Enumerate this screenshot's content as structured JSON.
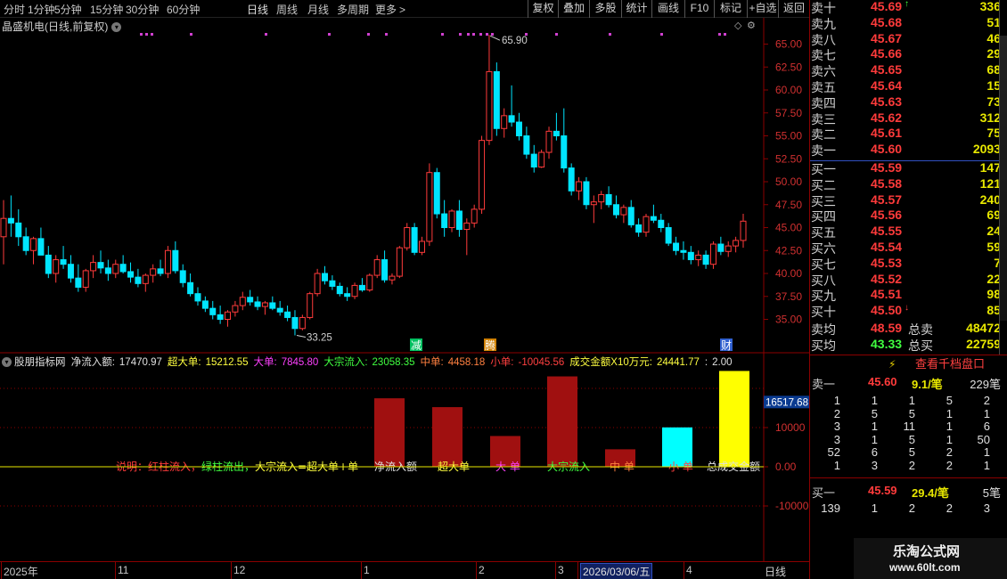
{
  "toolbar": {
    "left_items": [
      "分时",
      "1分钟",
      "5分钟",
      "15分钟",
      "30分钟",
      "60分钟",
      "日线",
      "周线",
      "月线",
      "多周期",
      "更多"
    ],
    "active": "日线",
    "right_items": [
      "复权",
      "叠加",
      "多股",
      "统计",
      "画线",
      "F10",
      "标记",
      "+自选",
      "返回"
    ]
  },
  "stock": {
    "title": "晶盛机电(日线,前复权)"
  },
  "main_chart": {
    "y_ticks": [
      "65.00",
      "62.50",
      "60.00",
      "57.50",
      "55.00",
      "52.50",
      "50.00",
      "47.50",
      "45.00",
      "42.50",
      "40.00",
      "37.50",
      "35.00"
    ],
    "high_label": "65.90",
    "low_label": "33.25",
    "event_marks": [
      {
        "text": "减",
        "color": "#00c060"
      },
      {
        "text": "腾",
        "color": "#d08000"
      },
      {
        "text": "财",
        "color": "#3060d0"
      }
    ],
    "colors": {
      "up": "#ff3b3b",
      "down": "#00e5ff"
    }
  },
  "indicator": {
    "name": "股朋指标网",
    "fields": [
      {
        "label": "净流入额:",
        "value": "17470.97",
        "color": "#e0e0e0"
      },
      {
        "label": "超大单:",
        "value": "15212.55",
        "color": "#ffff40"
      },
      {
        "label": "大单:",
        "value": "7845.80",
        "color": "#ff40ff"
      },
      {
        "label": "大宗流入:",
        "value": "23058.35",
        "color": "#40ff40"
      },
      {
        "label": "中单:",
        "value": "4458.18",
        "color": "#ff8040"
      },
      {
        "label": "小单:",
        "value": "-10045.56",
        "color": "#ff4040"
      },
      {
        "label": "成交金额X10万元:",
        "value": "24441.77",
        "color": "#ffff40"
      },
      {
        "label": ":",
        "value": "2.00",
        "color": "#e0e0e0"
      }
    ],
    "current_value": "16517.68",
    "note_parts": [
      {
        "text": "说明：红柱流入，",
        "color": "#ff3b3b"
      },
      {
        "text": "绿柱流出，",
        "color": "#40ff40"
      },
      {
        "text": "大宗流入=超大单+单",
        "color": "#ffff40"
      }
    ],
    "bar_labels": [
      {
        "text": "净流入额",
        "color": "#e0e0e0"
      },
      {
        "text": "超大单",
        "color": "#ffff40"
      },
      {
        "text": "大  单",
        "color": "#ff40ff"
      },
      {
        "text": "大宗流入",
        "color": "#40ff40"
      },
      {
        "text": "中  单",
        "color": "#ff8040"
      },
      {
        "text": "小  单",
        "color": "#ff4040"
      },
      {
        "text": "总成交金额",
        "color": "#e0e0e0"
      }
    ]
  },
  "chart_data": {
    "type": "bar",
    "categories": [
      "净流入额",
      "超大单",
      "大单",
      "大宗流入",
      "中单",
      "小单",
      "成交金额X10万元"
    ],
    "values": [
      17470.97,
      15212.55,
      7845.8,
      23058.35,
      4458.18,
      -10045.56,
      24441.77
    ],
    "bar_colors": [
      "#a01010",
      "#a01010",
      "#a01010",
      "#a01010",
      "#a01010",
      "#00ffff",
      "#ffff00"
    ],
    "y_ticks": [
      "10000",
      "0.00",
      "-10000"
    ],
    "ylim": [
      -13000,
      25500
    ]
  },
  "order_book": {
    "asks": [
      {
        "label": "卖十",
        "price": "45.69",
        "vol": "336",
        "mark": "↑"
      },
      {
        "label": "卖九",
        "price": "45.68",
        "vol": "51"
      },
      {
        "label": "卖八",
        "price": "45.67",
        "vol": "46"
      },
      {
        "label": "卖七",
        "price": "45.66",
        "vol": "29"
      },
      {
        "label": "卖六",
        "price": "45.65",
        "vol": "68"
      },
      {
        "label": "卖五",
        "price": "45.64",
        "vol": "15"
      },
      {
        "label": "卖四",
        "price": "45.63",
        "vol": "73"
      },
      {
        "label": "卖三",
        "price": "45.62",
        "vol": "312"
      },
      {
        "label": "卖二",
        "price": "45.61",
        "vol": "75"
      },
      {
        "label": "卖一",
        "price": "45.60",
        "vol": "2093"
      }
    ],
    "bids": [
      {
        "label": "买一",
        "price": "45.59",
        "vol": "147"
      },
      {
        "label": "买二",
        "price": "45.58",
        "vol": "121"
      },
      {
        "label": "买三",
        "price": "45.57",
        "vol": "240"
      },
      {
        "label": "买四",
        "price": "45.56",
        "vol": "69"
      },
      {
        "label": "买五",
        "price": "45.55",
        "vol": "24"
      },
      {
        "label": "买六",
        "price": "45.54",
        "vol": "59"
      },
      {
        "label": "买七",
        "price": "45.53",
        "vol": "7"
      },
      {
        "label": "买八",
        "price": "45.52",
        "vol": "22"
      },
      {
        "label": "买九",
        "price": "45.51",
        "vol": "98"
      },
      {
        "label": "买十",
        "price": "45.50",
        "vol": "85",
        "mark": "↓"
      }
    ],
    "sell_avg_label": "卖均",
    "sell_avg": "48.59",
    "sell_total_label": "总卖",
    "sell_total": "48472",
    "buy_avg_label": "买均",
    "buy_avg": "43.33",
    "buy_total_label": "总买",
    "buy_total": "22759"
  },
  "queue": {
    "button_label": "查看千档盘口",
    "ask_label": "卖一",
    "ask_price": "45.60",
    "ask_avg": "9.1/笔",
    "ask_count": "229笔",
    "ask_rows": [
      [
        "1",
        "1",
        "1",
        "5",
        "2"
      ],
      [
        "2",
        "5",
        "5",
        "1",
        "1"
      ],
      [
        "3",
        "1",
        "11",
        "1",
        "6"
      ],
      [
        "3",
        "1",
        "5",
        "1",
        "50"
      ],
      [
        "52",
        "6",
        "5",
        "2",
        "1"
      ],
      [
        "1",
        "3",
        "2",
        "2",
        "1"
      ]
    ],
    "bid_label": "买一",
    "bid_price": "45.59",
    "bid_avg": "29.4/笔",
    "bid_count": "5笔",
    "bid_rows": [
      [
        "139",
        "1",
        "2",
        "2",
        "3"
      ]
    ]
  },
  "bottom": {
    "dates": [
      "2025年",
      "11",
      "12",
      "1",
      "2",
      "3",
      "2026/03/06/五",
      "4"
    ],
    "period": "日线"
  },
  "watermark": {
    "line1": "乐淘公式网",
    "line2": "www.60lt.com"
  }
}
